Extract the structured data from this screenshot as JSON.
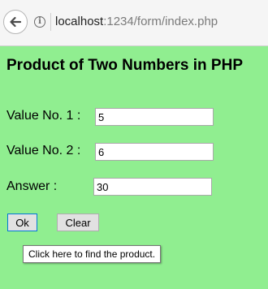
{
  "browser": {
    "url_host": "localhost",
    "url_path": ":1234/form/index.php"
  },
  "page": {
    "title": "Product of Two Numbers in PHP"
  },
  "form": {
    "value1_label": "Value No. 1 :",
    "value1": "5",
    "value2_label": "Value No. 2 :",
    "value2": "6",
    "answer_label": "Answer :",
    "answer": "30",
    "ok_label": "Ok",
    "clear_label": "Clear"
  },
  "tooltip": {
    "text": "Click here to find the product."
  }
}
